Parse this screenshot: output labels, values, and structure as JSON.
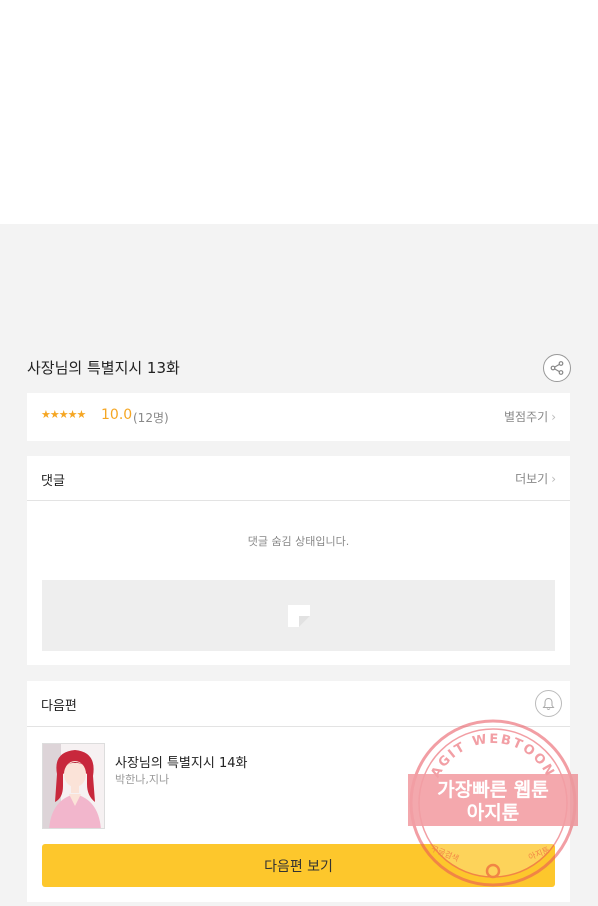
{
  "episode": {
    "title": "사장님의 특별지시 13화"
  },
  "rating": {
    "stars": "★★★★★",
    "score": "10.0",
    "count": "(12명)",
    "rate_link": "별점주기"
  },
  "comments": {
    "title": "댓글",
    "more": "더보기",
    "hidden_message": "댓글 숨김 상태입니다."
  },
  "next": {
    "title": "다음편",
    "episode_title": "사장님의 특별지시 14화",
    "authors": "박한나,지나",
    "button_label": "다음편 보기"
  },
  "watermark": {
    "top_text": "AGIT WEBTOON",
    "line1": "가장빠른 웹툰",
    "line2": "아지툰",
    "bottom_left": "구글검색",
    "bottom_right": "아지툰"
  },
  "colors": {
    "accent_yellow": "#fdc72c",
    "star_orange": "#f5a623",
    "watermark_red": "#e8505a"
  }
}
